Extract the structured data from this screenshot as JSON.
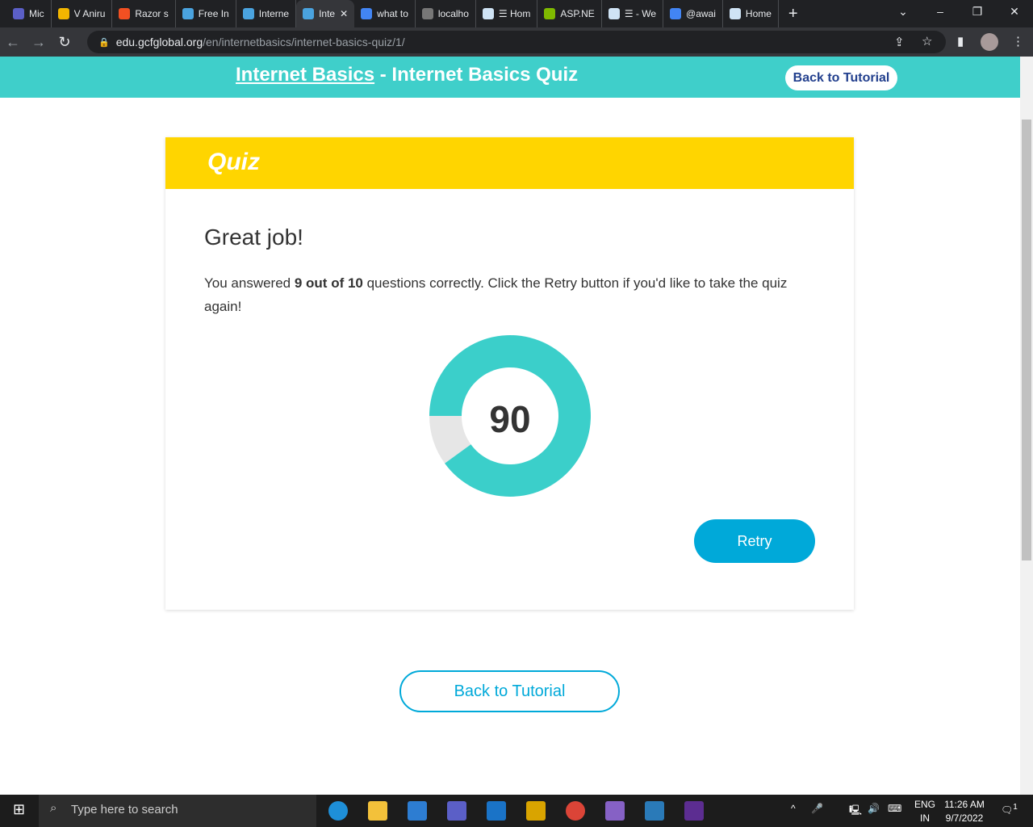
{
  "browser": {
    "tabs": [
      {
        "title": "Mic",
        "color": "#5b5fc7"
      },
      {
        "title": "V Aniru",
        "color": "#f2b600"
      },
      {
        "title": "Razor s",
        "color": "#f25022"
      },
      {
        "title": "Free In",
        "color": "#4aa3df"
      },
      {
        "title": "Interne",
        "color": "#4aa3df"
      },
      {
        "title": "Inte",
        "color": "#4aa3df",
        "active": true
      },
      {
        "title": "what to",
        "color": "#4285f4"
      },
      {
        "title": "localho",
        "color": "#777"
      },
      {
        "title": "☰ Hom",
        "color": "#cfe3f5"
      },
      {
        "title": "ASP.NE",
        "color": "#7fba00"
      },
      {
        "title": "☰ - We",
        "color": "#cfe3f5"
      },
      {
        "title": "@awai",
        "color": "#4285f4"
      },
      {
        "title": "Home",
        "color": "#cfe3f5"
      }
    ],
    "url_host": "edu.gcfglobal.org",
    "url_path": "/en/internetbasics/internet-basics-quiz/1/"
  },
  "header": {
    "course_link": "Internet Basics",
    "separator": " - ",
    "title": "Internet Basics Quiz",
    "back_button": "Back to Tutorial"
  },
  "quiz": {
    "heading": "Quiz",
    "result_title": "Great job!",
    "msg_pre": "You answered ",
    "msg_bold": "9 out of 10",
    "msg_post": " questions correctly. Click the Retry button if you'd like to take the quiz again!",
    "score": "90",
    "score_percent": 90,
    "colors": {
      "correct": "#3bcfca",
      "incorrect": "#e6e6e6"
    },
    "retry_button": "Retry"
  },
  "footer": {
    "back_button": "Back to Tutorial"
  },
  "taskbar": {
    "search_placeholder": "Type here to search",
    "lang": "ENG",
    "region": "IN",
    "time": "11:26 AM",
    "date": "9/7/2022",
    "notifications": "1"
  }
}
